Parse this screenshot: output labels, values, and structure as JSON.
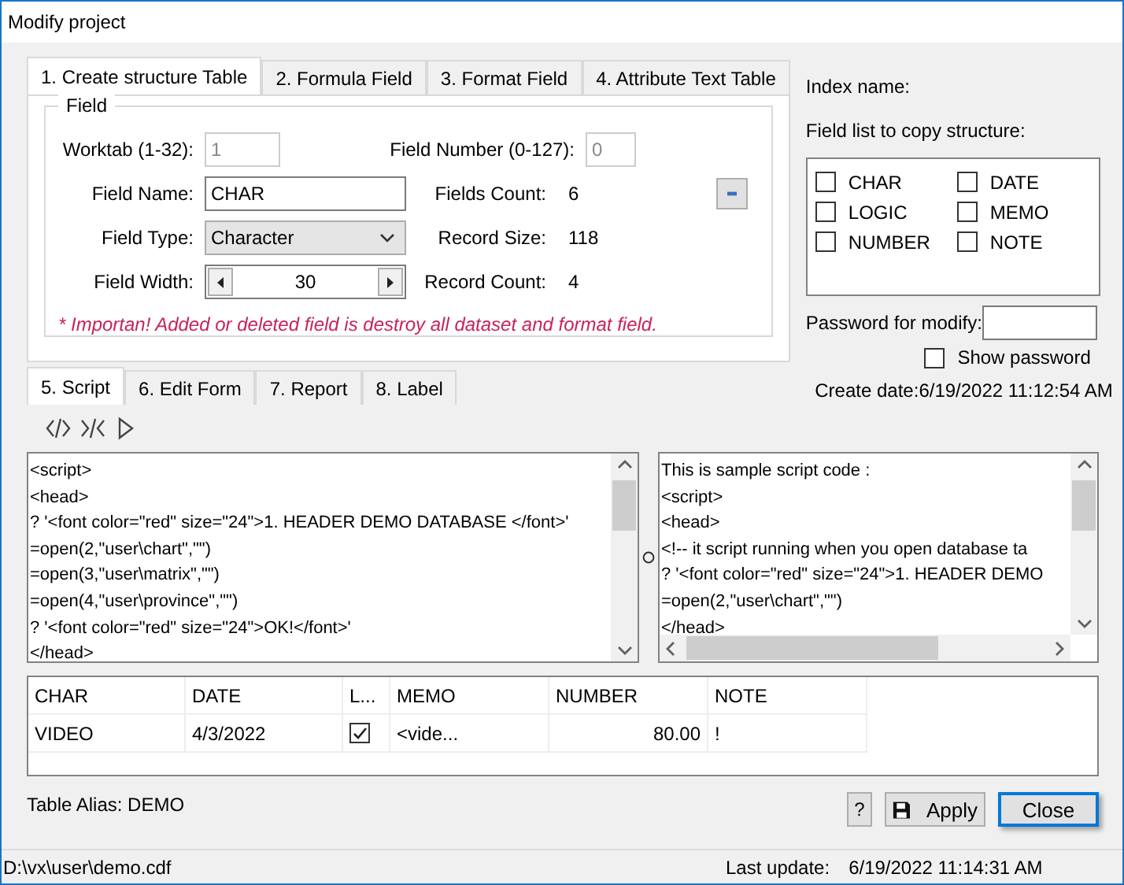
{
  "window": {
    "title": "Modify project"
  },
  "structure_tabs": [
    {
      "label": "1. Create structure Table",
      "selected": true
    },
    {
      "label": "2. Formula Field",
      "selected": false
    },
    {
      "label": "3. Format Field",
      "selected": false
    },
    {
      "label": "4. Attribute Text Table",
      "selected": false
    }
  ],
  "field_group": {
    "title": "Field",
    "worktab": {
      "label": "Worktab (1-32):",
      "value": "1",
      "disabled": true
    },
    "field_number": {
      "label": "Field Number (0-127):",
      "value": "0",
      "disabled": true
    },
    "field_name": {
      "label": "Field Name:",
      "value": "CHAR"
    },
    "field_type": {
      "label": "Field Type:",
      "value": "Character"
    },
    "field_width": {
      "label": "Field Width:",
      "value": "30"
    },
    "stats": [
      {
        "label": "Fields Count:",
        "value": "6"
      },
      {
        "label": "Record Size:",
        "value": "118"
      },
      {
        "label": "Record Count:",
        "value": "4"
      }
    ],
    "warning": "* Importan! Added or deleted field is destroy all dataset and format field."
  },
  "index_name_label": "Index name:",
  "copy_list": {
    "label": "Field list to copy structure:",
    "items": [
      {
        "label": "CHAR",
        "checked": false
      },
      {
        "label": "DATE",
        "checked": false
      },
      {
        "label": "LOGIC",
        "checked": false
      },
      {
        "label": "MEMO",
        "checked": false
      },
      {
        "label": "NUMBER",
        "checked": false
      },
      {
        "label": "NOTE",
        "checked": false
      }
    ]
  },
  "password": {
    "label": "Password for modify:"
  },
  "show_password": {
    "label": "Show password",
    "checked": false
  },
  "create_date": {
    "label": "Create date:",
    "value": "6/19/2022 11:12:54 AM"
  },
  "script_tabs": [
    {
      "label": "5. Script",
      "selected": true
    },
    {
      "label": "6. Edit Form",
      "selected": false
    },
    {
      "label": "7. Report",
      "selected": false
    },
    {
      "label": "8. Label",
      "selected": false
    }
  ],
  "script_editor": {
    "lines": [
      "<script>",
      "<head>",
      "? '<font color=\"red\" size=\"24\">1. HEADER DEMO DATABASE </font>'",
      "=open(2,\"user\\chart\",\"\")",
      "=open(3,\"user\\matrix\",\"\")",
      "=open(4,\"user\\province\",\"\")",
      "? '<font color=\"red\" size=\"24\">OK!</font>'",
      "</head>"
    ]
  },
  "sample_editor": {
    "lines": [
      "This is sample script code :",
      "<script>",
      "<head>",
      "<!-- it script running when you open database ta",
      "? '<font color=\"red\" size=\"24\">1. HEADER DEMO",
      "=open(2,\"user\\chart\",\"\")",
      "</head>"
    ]
  },
  "grid": {
    "columns": [
      "CHAR",
      "DATE",
      "L...",
      "MEMO",
      "NUMBER",
      "NOTE"
    ],
    "rows": [
      {
        "cells": [
          {
            "kind": "text",
            "text": "VIDEO"
          },
          {
            "kind": "text",
            "text": "4/3/2022"
          },
          {
            "kind": "check",
            "checked": true
          },
          {
            "kind": "text",
            "text": "<vide..."
          },
          {
            "kind": "number",
            "text": "80.00"
          },
          {
            "kind": "text",
            "text": "!"
          }
        ]
      }
    ]
  },
  "table_alias": {
    "label": "Table Alias:",
    "value": "DEMO"
  },
  "buttons": [
    {
      "kind": "help",
      "label": "?",
      "default": false
    },
    {
      "kind": "apply",
      "label": "Apply",
      "default": false
    },
    {
      "kind": "close",
      "label": "Close",
      "default": true
    }
  ],
  "status_bar": {
    "path": "D:\\vx\\user\\demo.cdf",
    "last_update_label": "Last update:",
    "last_update": "6/19/2022 11:14:31 AM"
  }
}
